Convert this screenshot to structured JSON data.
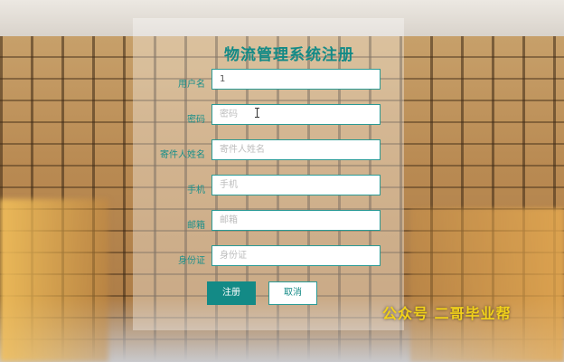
{
  "form": {
    "title": "物流管理系统注册",
    "fields": [
      {
        "label": "用户名",
        "value": "1",
        "placeholder": ""
      },
      {
        "label": "密码",
        "value": "",
        "placeholder": "密码"
      },
      {
        "label": "寄件人姓名",
        "value": "",
        "placeholder": "寄件人姓名"
      },
      {
        "label": "手机",
        "value": "",
        "placeholder": "手机"
      },
      {
        "label": "邮箱",
        "value": "",
        "placeholder": "邮箱"
      },
      {
        "label": "身份证",
        "value": "",
        "placeholder": "身份证"
      }
    ],
    "register_label": "注册",
    "cancel_label": "取消"
  },
  "watermark": "公众号 二哥毕业帮",
  "colors": {
    "accent": "#138a86",
    "watermark": "#f2d21a"
  }
}
